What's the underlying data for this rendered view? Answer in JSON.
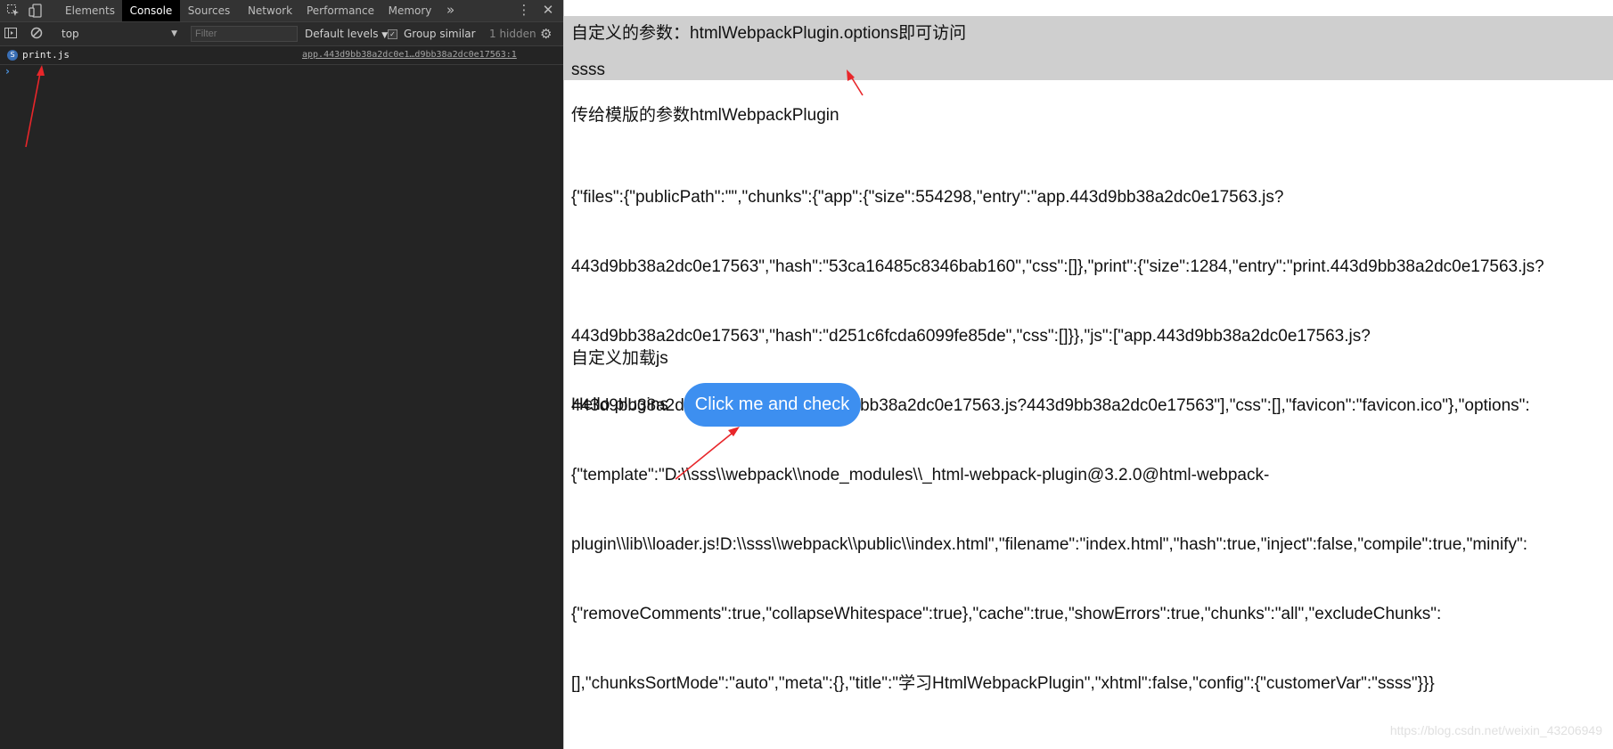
{
  "devtools": {
    "tabs": [
      "Elements",
      "Console",
      "Sources",
      "Network",
      "Performance",
      "Memory"
    ],
    "active_tab": "Console",
    "more_tabs_label": "»",
    "toolbar": {
      "context": "top",
      "filter_placeholder": "Filter",
      "levels": "Default levels",
      "group_similar": "Group similar",
      "hidden_count": "1 hidden"
    },
    "console": {
      "message": "print.js",
      "source": "app.443d9bb38a2dc0e1…d9bb38a2dc0e17563:1",
      "prompt": "›"
    }
  },
  "page": {
    "line1": "自定义的参数：htmlWebpackPlugin.options即可访问",
    "line2": "ssss",
    "line3": "传给模版的参数htmlWebpackPlugin",
    "json_lines": [
      "{\"files\":{\"publicPath\":\"\",\"chunks\":{\"app\":{\"size\":554298,\"entry\":\"app.443d9bb38a2dc0e17563.js?",
      "443d9bb38a2dc0e17563\",\"hash\":\"53ca16485c8346bab160\",\"css\":[]},\"print\":{\"size\":1284,\"entry\":\"print.443d9bb38a2dc0e17563.js?",
      "443d9bb38a2dc0e17563\",\"hash\":\"d251c6fcda6099fe85de\",\"css\":[]}},\"js\":[\"app.443d9bb38a2dc0e17563.js?",
      "443d9bb38a2dc0e17563\",\"print.443d9bb38a2dc0e17563.js?443d9bb38a2dc0e17563\"],\"css\":[],\"favicon\":\"favicon.ico\"},\"options\":",
      "{\"template\":\"D:\\\\sss\\\\webpack\\\\node_modules\\\\_html-webpack-plugin@3.2.0@html-webpack-",
      "plugin\\\\lib\\\\loader.js!D:\\\\sss\\\\webpack\\\\public\\\\index.html\",\"filename\":\"index.html\",\"hash\":true,\"inject\":false,\"compile\":true,\"minify\":",
      "{\"removeComments\":true,\"collapseWhitespace\":true},\"cache\":true,\"showErrors\":true,\"chunks\":\"all\",\"excludeChunks\":",
      "[],\"chunksSortMode\":\"auto\",\"meta\":{},\"title\":\"学习HtmlWebpackPlugin\",\"xhtml\":false,\"config\":{\"customerVar\":\"ssss\"}}}"
    ],
    "line4": "自定义加载js",
    "hello": "Hello plugins",
    "button": "Click me and check",
    "watermark": "https://blog.csdn.net/weixin_43206949"
  },
  "colors": {
    "devtools_bg": "#242424",
    "highlight_bg": "#cfcfcf",
    "button_bg": "#3d8ff0",
    "annotation_arrow": "#e8262a"
  },
  "icons": [
    "inspect-element-icon",
    "device-toggle-icon",
    "sidebar-toggle-icon",
    "clear-console-icon",
    "kebab-menu-icon",
    "close-icon",
    "settings-gear-icon",
    "script-badge-icon",
    "annotation-arrow"
  ]
}
